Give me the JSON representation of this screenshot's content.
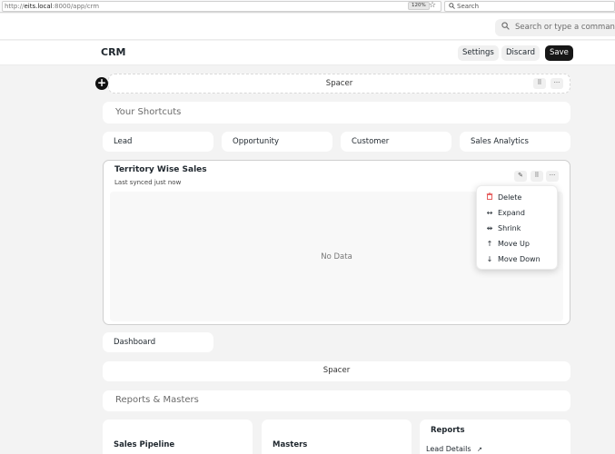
{
  "browser": {
    "url_scheme": "http://",
    "url_host": "eits.local",
    "url_path": ":8000/app/crm",
    "zoom": "120%",
    "search_placeholder": "Search"
  },
  "navbar": {
    "search_placeholder": "Search or type a command (Ctrl + G)"
  },
  "page": {
    "title": "CRM",
    "buttons": {
      "settings": "Settings",
      "discard": "Discard",
      "save": "Save"
    }
  },
  "blocks": {
    "spacer_top": "Spacer",
    "shortcuts_heading": "Your Shortcuts",
    "shortcuts": [
      "Lead",
      "Opportunity",
      "Customer",
      "Sales Analytics"
    ],
    "chart": {
      "title": "Territory Wise Sales",
      "subtitle": "Last synced just now",
      "empty": "No Data"
    },
    "menu": [
      {
        "label": "Delete",
        "icon": "trash-icon"
      },
      {
        "label": "Expand",
        "icon": "expand-icon"
      },
      {
        "label": "Shrink",
        "icon": "shrink-icon"
      },
      {
        "label": "Move Up",
        "icon": "arrow-up-icon"
      },
      {
        "label": "Move Down",
        "icon": "arrow-down-icon"
      }
    ],
    "dashboard": "Dashboard",
    "spacer_bottom": "Spacer",
    "reports_heading": "Reports & Masters",
    "cards": {
      "sales_pipeline": "Sales Pipeline",
      "masters": "Masters",
      "reports": "Reports"
    },
    "reports_link": "Lead Details"
  },
  "colors": {
    "primary_dark": "#171717",
    "danger": "#e03636",
    "background": "#f3f3f3"
  }
}
